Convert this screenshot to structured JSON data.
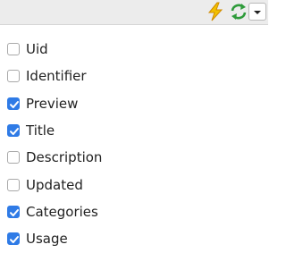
{
  "toolbar": {
    "icons": [
      "lightning-icon",
      "refresh-icon",
      "dropdown-caret-icon"
    ],
    "accent": "#2f7be6"
  },
  "menu": {
    "items": [
      {
        "label": "Uid",
        "checked": false
      },
      {
        "label": "Identifier",
        "checked": false
      },
      {
        "label": "Preview",
        "checked": true
      },
      {
        "label": "Title",
        "checked": true
      },
      {
        "label": "Description",
        "checked": false
      },
      {
        "label": "Updated",
        "checked": false
      },
      {
        "label": "Categories",
        "checked": true
      },
      {
        "label": "Usage",
        "checked": true
      }
    ]
  }
}
